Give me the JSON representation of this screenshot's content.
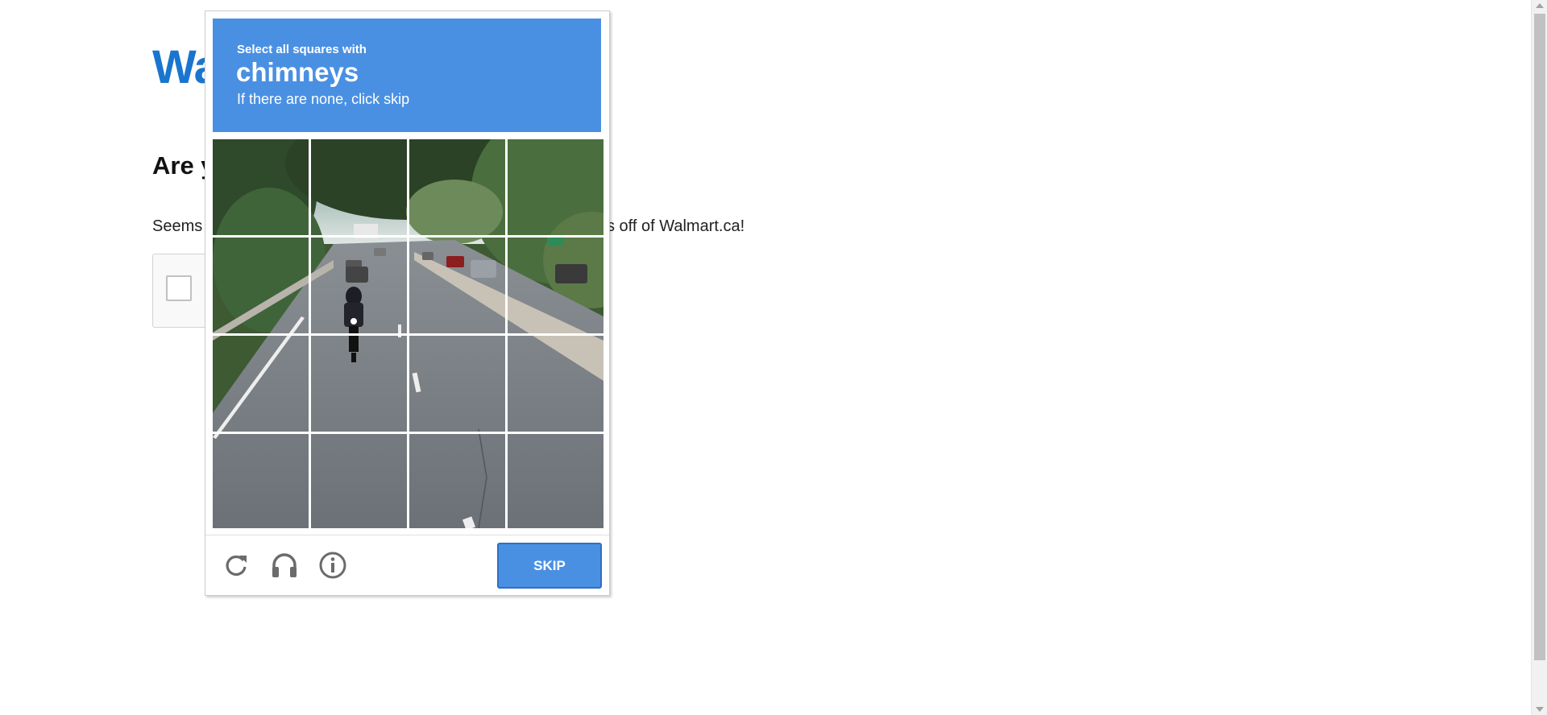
{
  "page": {
    "logo": "Wa",
    "heading": "Are y",
    "paragraph_start": "Seems",
    "paragraph_end": "s off of Walmart.ca!"
  },
  "challenge": {
    "instruction": "Select all squares with",
    "target": "chimneys",
    "hint": "If there are none, click skip",
    "header_color": "#4a90e2",
    "tiles": [
      "tile-1",
      "tile-2",
      "tile-3",
      "tile-4",
      "tile-5",
      "tile-6",
      "tile-7",
      "tile-8",
      "tile-9",
      "tile-10",
      "tile-11",
      "tile-12",
      "tile-13",
      "tile-14",
      "tile-15",
      "tile-16"
    ],
    "footer": {
      "reload_icon": "reload-icon",
      "audio_icon": "headphones-icon",
      "info_icon": "info-icon",
      "skip_label": "SKIP"
    }
  }
}
